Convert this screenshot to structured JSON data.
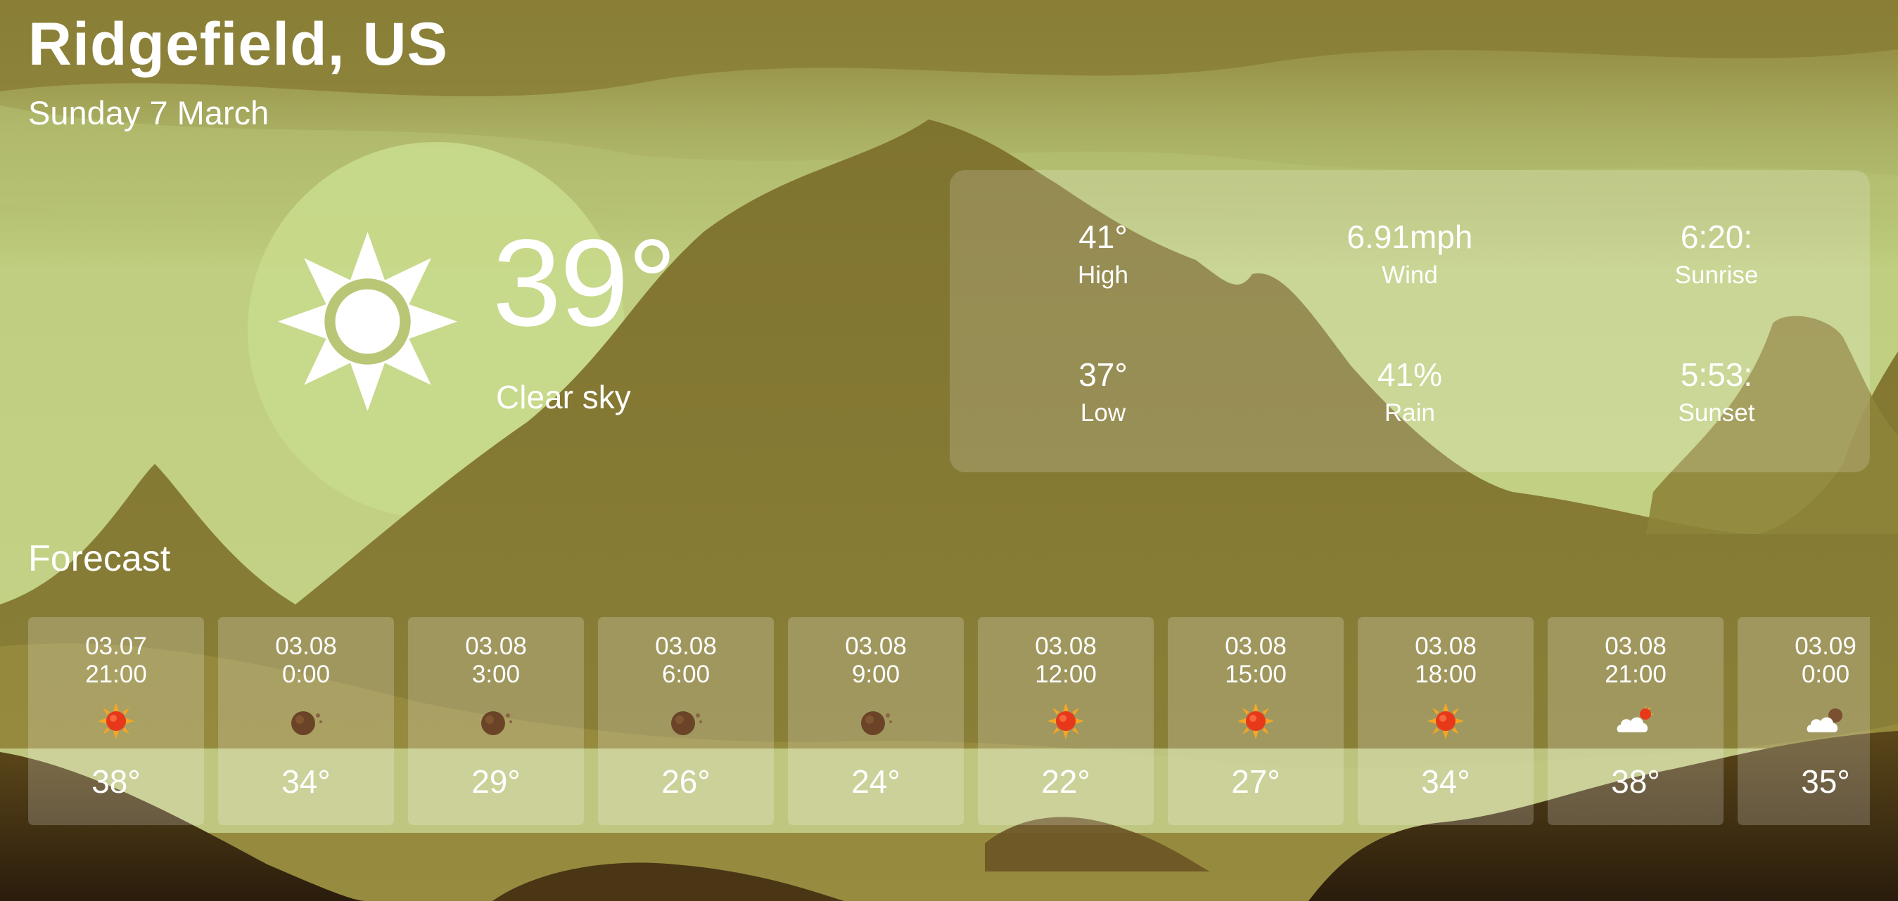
{
  "location": {
    "city": "Ridgefield, US",
    "date": "Sunday 7 March"
  },
  "current": {
    "temperature": "39°",
    "condition": "Clear sky",
    "icon": "sun-icon"
  },
  "stats": {
    "high": {
      "value": "41°",
      "label": "High"
    },
    "wind": {
      "value": "6.91mph",
      "label": "Wind"
    },
    "sunrise": {
      "value": "6:20:",
      "label": "Sunrise"
    },
    "low": {
      "value": "37°",
      "label": "Low"
    },
    "rain": {
      "value": "41%",
      "label": "Rain"
    },
    "sunset": {
      "value": "5:53:",
      "label": "Sunset"
    }
  },
  "forecast": {
    "title": "Forecast",
    "items": [
      {
        "date": "03.07",
        "hour": "21:00",
        "temp": "38°",
        "icon": "sun-icon"
      },
      {
        "date": "03.08",
        "hour": "0:00",
        "temp": "34°",
        "icon": "moon-icon"
      },
      {
        "date": "03.08",
        "hour": "3:00",
        "temp": "29°",
        "icon": "moon-icon"
      },
      {
        "date": "03.08",
        "hour": "6:00",
        "temp": "26°",
        "icon": "moon-icon"
      },
      {
        "date": "03.08",
        "hour": "9:00",
        "temp": "24°",
        "icon": "moon-icon"
      },
      {
        "date": "03.08",
        "hour": "12:00",
        "temp": "22°",
        "icon": "sun-icon"
      },
      {
        "date": "03.08",
        "hour": "15:00",
        "temp": "27°",
        "icon": "sun-icon"
      },
      {
        "date": "03.08",
        "hour": "18:00",
        "temp": "34°",
        "icon": "sun-icon"
      },
      {
        "date": "03.08",
        "hour": "21:00",
        "temp": "38°",
        "icon": "cloud-sun-icon"
      },
      {
        "date": "03.09",
        "hour": "0:00",
        "temp": "35°",
        "icon": "cloud-moon-icon"
      }
    ]
  },
  "colors": {
    "sky": "#c1d183",
    "mountain": "#857a34",
    "foreground": "#3c2a12",
    "text": "#ffffff",
    "sun_icon": "#e7391a",
    "moon_icon": "#7a5030"
  }
}
